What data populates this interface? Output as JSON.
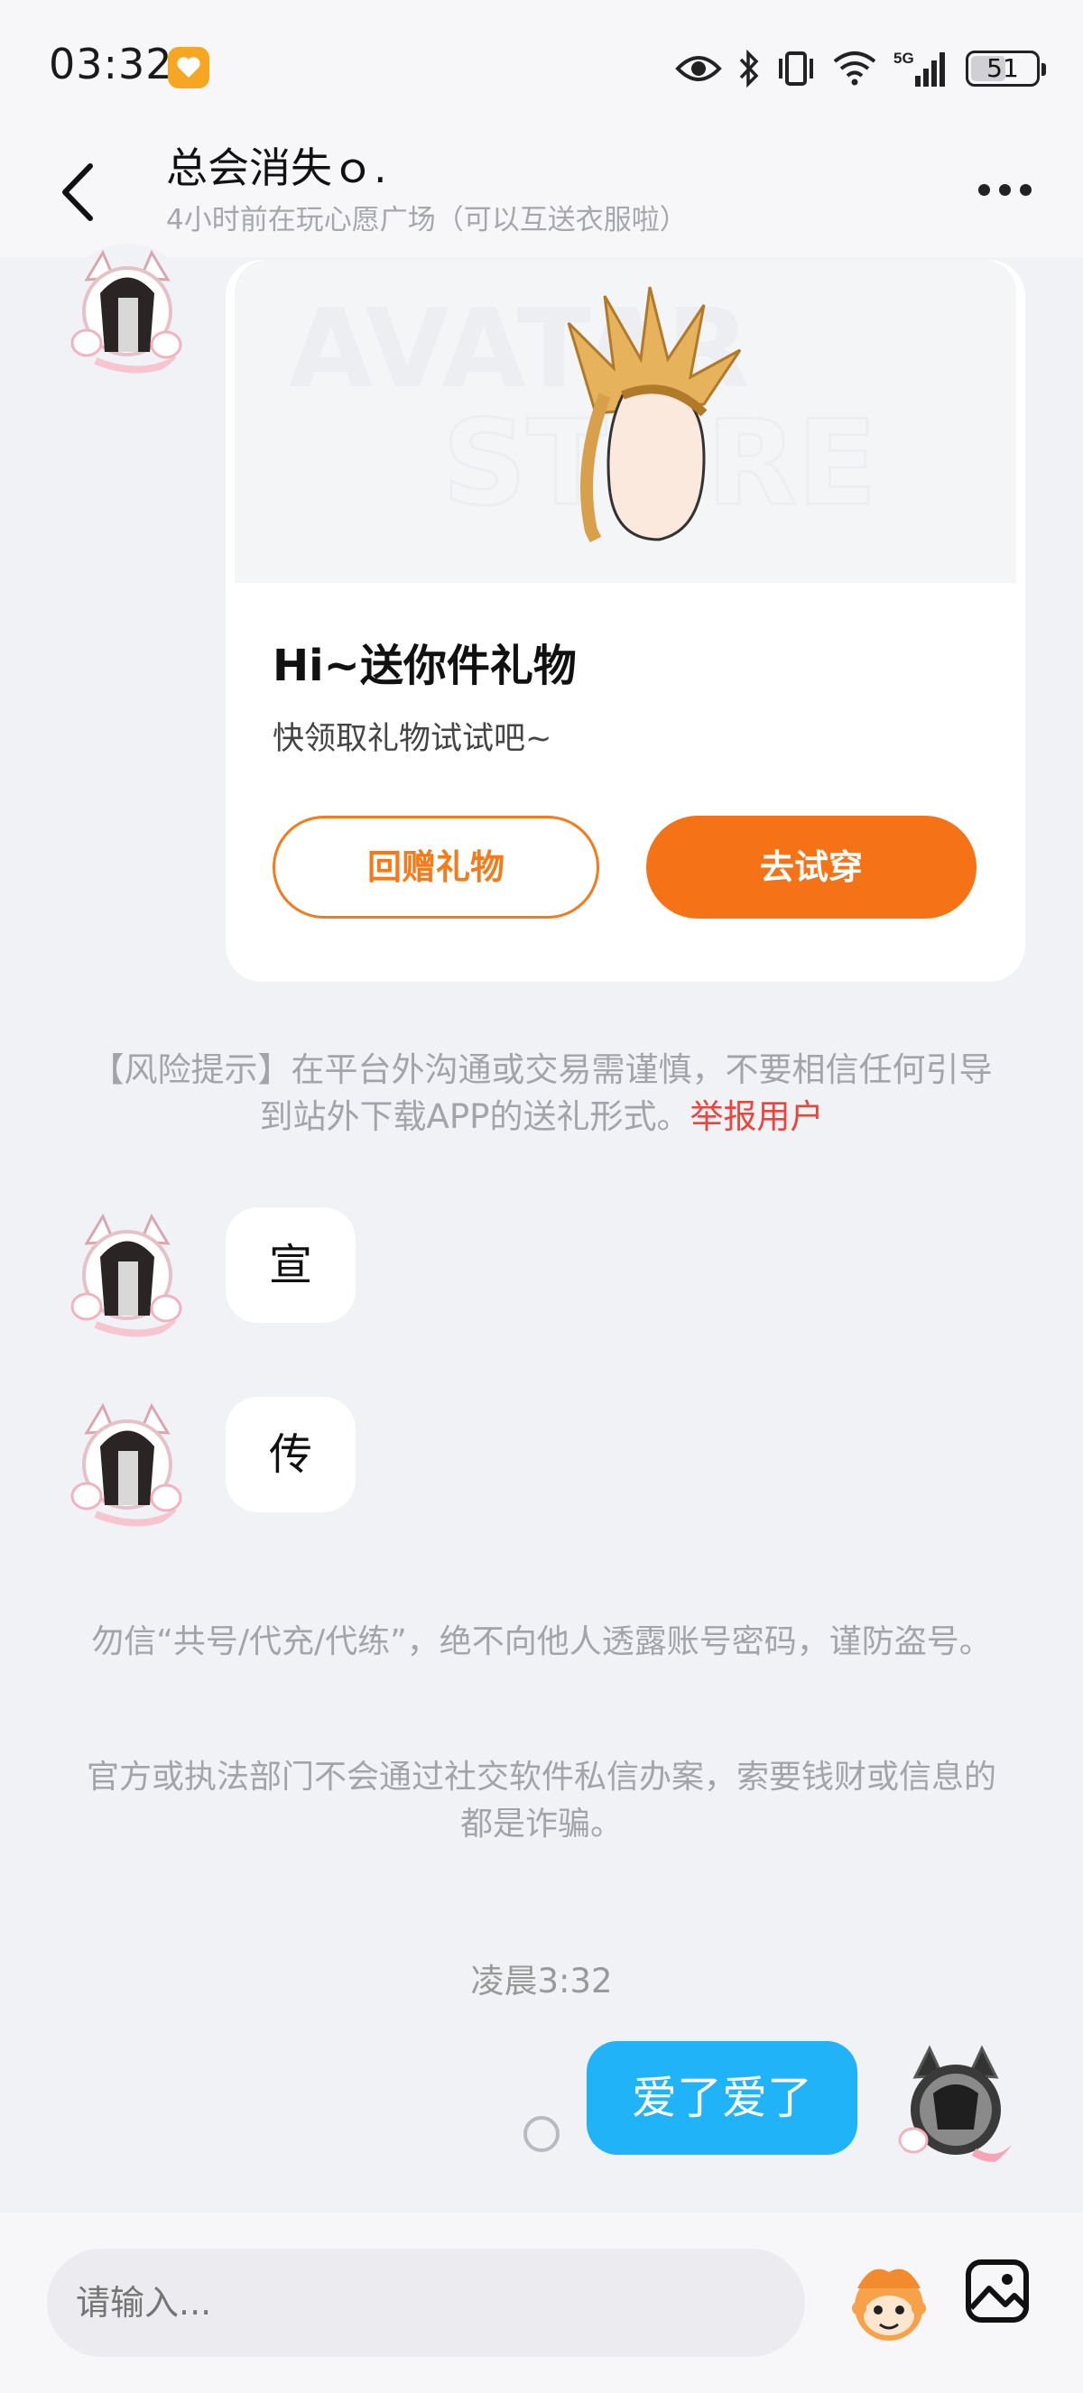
{
  "status_bar": {
    "time": "03:32",
    "battery": "51",
    "network": "5G"
  },
  "header": {
    "title": "总会消失ｏ.",
    "subtitle": "4小时前在玩心愿广场（可以互送衣服啦）"
  },
  "gift_card": {
    "watermark_line1": "AVATAR",
    "watermark_line2": "STORE",
    "title": "Hi~送你件礼物",
    "desc": "快领取礼物试试吧~",
    "return_gift_label": "回赠礼物",
    "try_on_label": "去试穿"
  },
  "risk_notice": {
    "text": "【风险提示】在平台外沟通或交易需谨慎，不要相信任何引导到站外下载APP的送礼形式。",
    "report_label": "举报用户"
  },
  "messages_in": [
    {
      "text": "宣"
    },
    {
      "text": "传"
    }
  ],
  "security_notices": [
    "勿信“共号/代充/代练”，绝不向他人透露账号密码，谨防盗号。",
    "官方或执法部门不会通过社交软件私信办案，索要钱财或信息的都是诈骗。"
  ],
  "timestamp": "凌晨3:32",
  "message_out": {
    "text": "爱了爱了"
  },
  "input": {
    "placeholder": "请输入..."
  },
  "colors": {
    "accent_orange": "#f57316",
    "bubble_blue": "#20b3f7",
    "report_red": "#e8453c"
  },
  "icons": [
    "back-icon",
    "more-icon",
    "eye-icon",
    "bluetooth-icon",
    "vibrate-icon",
    "wifi-icon",
    "signal-icon",
    "emoji-icon",
    "image-icon"
  ]
}
